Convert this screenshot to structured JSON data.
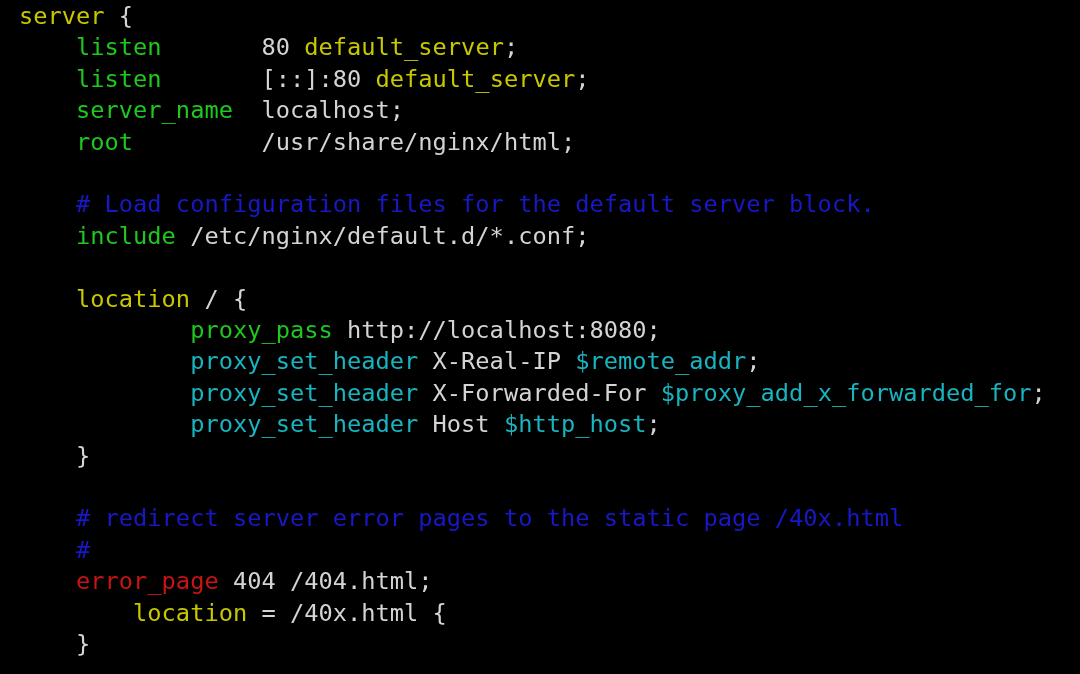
{
  "blocks": [
    [
      {
        "segments": [
          {
            "kind": "section",
            "text": "server"
          },
          {
            "kind": "value",
            "text": " {"
          }
        ]
      },
      {
        "segments": [
          {
            "kind": "directive",
            "text": "    listen"
          },
          {
            "kind": "value",
            "text": "       80 "
          },
          {
            "kind": "section",
            "text": "default_server"
          },
          {
            "kind": "value",
            "text": ";"
          }
        ]
      },
      {
        "segments": [
          {
            "kind": "directive",
            "text": "    listen"
          },
          {
            "kind": "value",
            "text": "       [::]:80 "
          },
          {
            "kind": "section",
            "text": "default_server"
          },
          {
            "kind": "value",
            "text": ";"
          }
        ]
      },
      {
        "segments": [
          {
            "kind": "directive",
            "text": "    server_name"
          },
          {
            "kind": "value",
            "text": "  localhost;"
          }
        ]
      },
      {
        "segments": [
          {
            "kind": "directive",
            "text": "    root"
          },
          {
            "kind": "value",
            "text": "         /usr/share/nginx/html;"
          }
        ]
      }
    ],
    [
      {
        "segments": [
          {
            "kind": "comment",
            "text": "    # Load configuration files for the default server block."
          }
        ]
      },
      {
        "segments": [
          {
            "kind": "directive",
            "text": "    include"
          },
          {
            "kind": "value",
            "text": " /etc/nginx/default.d/*.conf;"
          }
        ]
      }
    ],
    [
      {
        "segments": [
          {
            "kind": "section",
            "text": "    location"
          },
          {
            "kind": "value",
            "text": " / {"
          }
        ]
      },
      {
        "segments": [
          {
            "kind": "directive",
            "text": "            proxy_pass"
          },
          {
            "kind": "value",
            "text": " http://localhost:8080;"
          }
        ]
      },
      {
        "segments": [
          {
            "kind": "variable",
            "text": "            proxy_set_header"
          },
          {
            "kind": "value",
            "text": " X-Real-IP "
          },
          {
            "kind": "variable",
            "text": "$remote_addr"
          },
          {
            "kind": "value",
            "text": ";"
          }
        ]
      },
      {
        "segments": [
          {
            "kind": "variable",
            "text": "            proxy_set_header"
          },
          {
            "kind": "value",
            "text": " X-Forwarded-For "
          },
          {
            "kind": "variable",
            "text": "$proxy_add_x_forwarded_for"
          },
          {
            "kind": "value",
            "text": ";"
          }
        ]
      },
      {
        "segments": [
          {
            "kind": "variable",
            "text": "            proxy_set_header"
          },
          {
            "kind": "value",
            "text": " Host "
          },
          {
            "kind": "variable",
            "text": "$http_host"
          },
          {
            "kind": "value",
            "text": ";"
          }
        ]
      },
      {
        "segments": [
          {
            "kind": "value",
            "text": "    }"
          }
        ]
      }
    ],
    [
      {
        "segments": [
          {
            "kind": "comment",
            "text": "    # redirect server error pages to the static page /40x.html"
          }
        ]
      },
      {
        "segments": [
          {
            "kind": "comment",
            "text": "    #"
          }
        ]
      },
      {
        "segments": [
          {
            "kind": "error",
            "text": "    error_page"
          },
          {
            "kind": "value",
            "text": " 404 /404.html;"
          }
        ]
      },
      {
        "segments": [
          {
            "kind": "section",
            "text": "        location"
          },
          {
            "kind": "value",
            "text": " = /40x.html {"
          }
        ]
      },
      {
        "segments": [
          {
            "kind": "value",
            "text": "    }"
          }
        ]
      }
    ]
  ]
}
